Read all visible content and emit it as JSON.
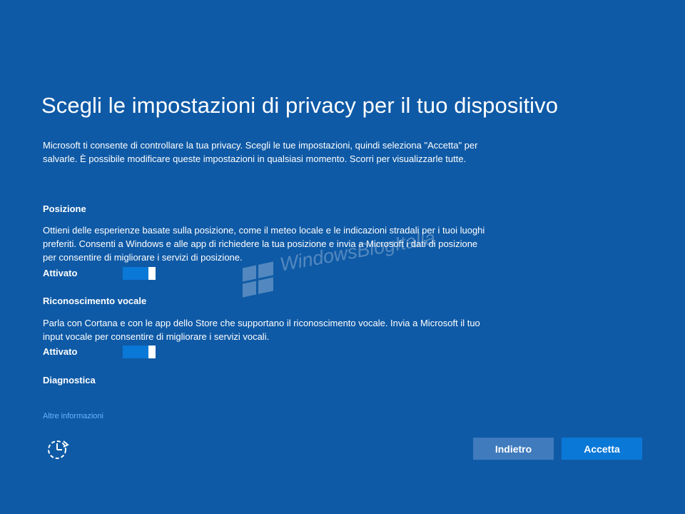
{
  "page": {
    "title": "Scegli le impostazioni di privacy per il tuo dispositivo",
    "intro": "Microsoft ti consente di controllare la tua privacy. Scegli le tue impostazioni, quindi seleziona \"Accetta\" per salvarle. È possibile modificare queste impostazioni in qualsiasi momento. Scorri per visualizzarle tutte."
  },
  "sections": [
    {
      "heading": "Posizione",
      "description": " Ottieni delle esperienze basate sulla posizione, come il meteo locale e le indicazioni stradali per i tuoi luoghi preferiti. Consenti a Windows e alle app di richiedere la tua posizione e invia a Microsoft i dati di posizione per consentire di migliorare i servizi di posizione.",
      "toggle_label": "Attivato",
      "toggle_on": true
    },
    {
      "heading": "Riconoscimento vocale",
      "description": "Parla con Cortana e con le app dello Store che supportano il riconoscimento vocale. Invia a Microsoft il tuo input vocale per consentire di migliorare i servizi vocali.",
      "toggle_label": "Attivato",
      "toggle_on": true
    },
    {
      "heading": "Diagnostica"
    }
  ],
  "footer": {
    "more_info_link": "Altre informazioni",
    "ease_icon": "ease-of-access-icon",
    "back_label": "Indietro",
    "accept_label": "Accetta"
  },
  "watermark": {
    "text": "WindowsBlogItalia",
    "logo": "windows-logo-icon"
  },
  "colors": {
    "background": "#0f5aa6",
    "toggle_on": "#0a78d7",
    "back_button": "#3f7bbd",
    "accept_button": "#0a78d7",
    "link": "#69b3ff"
  }
}
